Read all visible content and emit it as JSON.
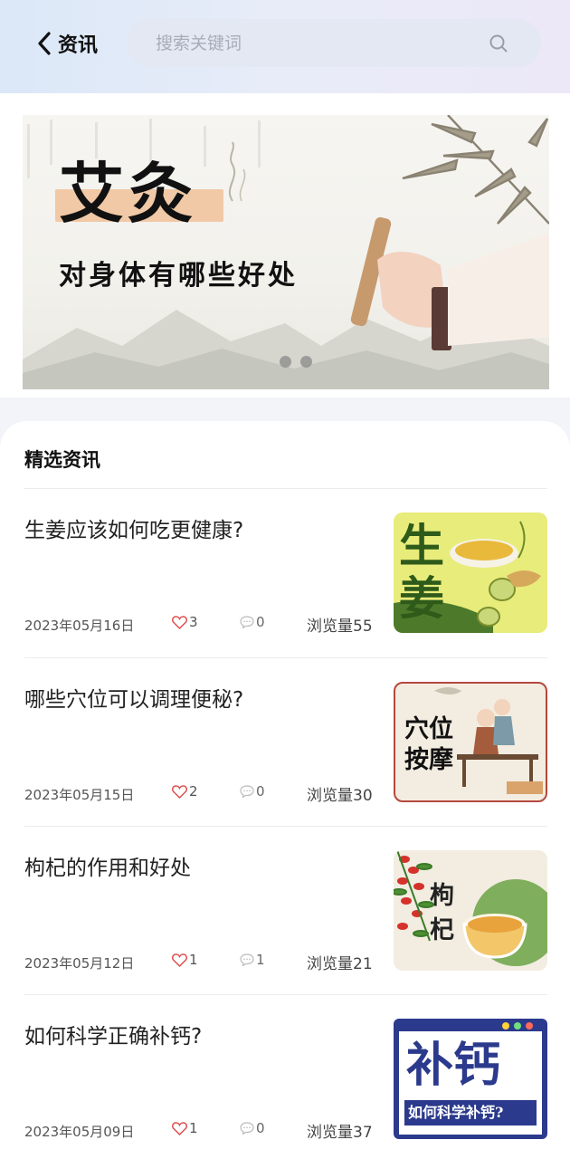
{
  "header": {
    "back_label": "资讯",
    "search_placeholder": "搜索关键词"
  },
  "banner": {
    "title": "艾灸",
    "subtitle": "对身体有哪些好处"
  },
  "section": {
    "title": "精选资讯"
  },
  "articles": [
    {
      "title": "生姜应该如何吃更健康?",
      "date": "2023年05月16日",
      "likes": "3",
      "comments": "0",
      "views": "浏览量55",
      "thumb_text": "生姜"
    },
    {
      "title": "哪些穴位可以调理便秘?",
      "date": "2023年05月15日",
      "likes": "2",
      "comments": "0",
      "views": "浏览量30",
      "thumb_text": "穴位按摩"
    },
    {
      "title": "枸杞的作用和好处",
      "date": "2023年05月12日",
      "likes": "1",
      "comments": "1",
      "views": "浏览量21",
      "thumb_text": "枸杞"
    },
    {
      "title": "如何科学正确补钙?",
      "date": "2023年05月09日",
      "likes": "1",
      "comments": "0",
      "views": "浏览量37",
      "thumb_text": "补钙",
      "thumb_subtext": "如何科学补钙?"
    }
  ],
  "colors": {
    "like_heart": "#e05050",
    "thumb_ginger_bg": "#e8ec7a",
    "thumb_calcium_bg": "#2b3a8c"
  }
}
